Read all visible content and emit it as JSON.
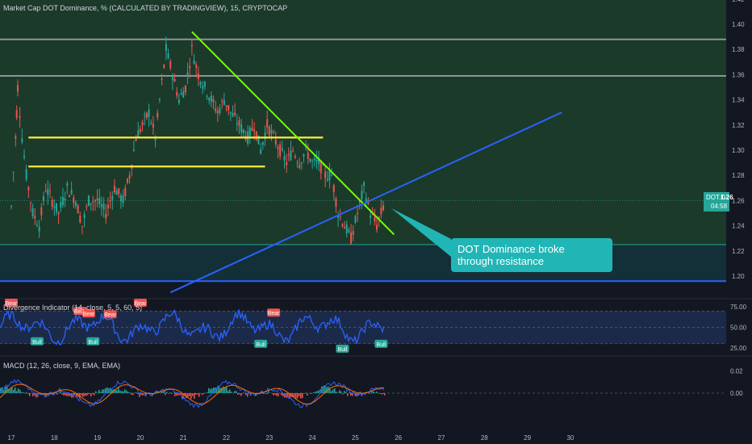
{
  "header": {
    "title": "Market Cap DOT Dominance, % (CALCULATED BY TRADINGVIEW), 15, CRYPTOCAP",
    "rsi_title": "Divergence Indicator (14, close, 5, 5, 60, 5)",
    "macd_title": "MACD (12, 26, close, 9, EMA, EMA)"
  },
  "price_tag": {
    "symbol": "DOT.D",
    "value": "1.26",
    "countdown": "04:58"
  },
  "callout": {
    "line1": "DOT Dominance broke",
    "line2": "through resistance"
  },
  "colors": {
    "background": "#131722",
    "candle_up": "#26a69a",
    "candle_down": "#ef5350",
    "resistance": "#ffeb3b",
    "trendline_down": "#76ff03",
    "trendline_up": "#2962ff",
    "support": "#2962ff",
    "zone_upper": "#1b3a2a",
    "zone_lower": "#133038"
  },
  "chart_data": [
    {
      "type": "candlestick",
      "title": "Market Cap DOT Dominance, %",
      "x_ticks": [
        "17",
        "18",
        "19",
        "20",
        "21",
        "22",
        "23",
        "24",
        "25",
        "26",
        "27",
        "28",
        "29",
        "30"
      ],
      "y_ticks": [
        "1.20",
        "1.22",
        "1.24",
        "1.26",
        "1.28",
        "1.30",
        "1.32",
        "1.34",
        "1.36",
        "1.38",
        "1.40",
        "1.42"
      ],
      "ylim": [
        1.187,
        1.42
      ],
      "last_value": 1.26,
      "approx_close": [
        [
          17.0,
          1.255
        ],
        [
          17.1,
          1.31
        ],
        [
          17.15,
          1.35
        ],
        [
          17.25,
          1.31
        ],
        [
          17.35,
          1.28
        ],
        [
          17.5,
          1.25
        ],
        [
          17.65,
          1.24
        ],
        [
          17.8,
          1.27
        ],
        [
          17.95,
          1.26
        ],
        [
          18.1,
          1.25
        ],
        [
          18.3,
          1.27
        ],
        [
          18.5,
          1.26
        ],
        [
          18.65,
          1.24
        ],
        [
          18.8,
          1.26
        ],
        [
          19.0,
          1.26
        ],
        [
          19.2,
          1.25
        ],
        [
          19.4,
          1.27
        ],
        [
          19.6,
          1.26
        ],
        [
          19.75,
          1.28
        ],
        [
          19.9,
          1.31
        ],
        [
          20.05,
          1.32
        ],
        [
          20.2,
          1.33
        ],
        [
          20.35,
          1.31
        ],
        [
          20.45,
          1.34
        ],
        [
          20.6,
          1.38
        ],
        [
          20.75,
          1.36
        ],
        [
          20.9,
          1.34
        ],
        [
          21.05,
          1.35
        ],
        [
          21.2,
          1.38
        ],
        [
          21.35,
          1.36
        ],
        [
          21.5,
          1.35
        ],
        [
          21.65,
          1.34
        ],
        [
          21.8,
          1.33
        ],
        [
          21.95,
          1.34
        ],
        [
          22.1,
          1.33
        ],
        [
          22.3,
          1.32
        ],
        [
          22.5,
          1.31
        ],
        [
          22.65,
          1.32
        ],
        [
          22.8,
          1.3
        ],
        [
          22.95,
          1.32
        ],
        [
          23.1,
          1.31
        ],
        [
          23.25,
          1.3
        ],
        [
          23.4,
          1.29
        ],
        [
          23.55,
          1.3
        ],
        [
          23.7,
          1.29
        ],
        [
          23.85,
          1.3
        ],
        [
          24.0,
          1.29
        ],
        [
          24.15,
          1.29
        ],
        [
          24.3,
          1.28
        ],
        [
          24.45,
          1.28
        ],
        [
          24.6,
          1.25
        ],
        [
          24.75,
          1.24
        ],
        [
          24.9,
          1.23
        ],
        [
          25.05,
          1.25
        ],
        [
          25.2,
          1.27
        ],
        [
          25.35,
          1.25
        ],
        [
          25.5,
          1.24
        ],
        [
          25.6,
          1.25
        ],
        [
          25.7,
          1.26
        ]
      ],
      "horizontal_lines": [
        {
          "name": "upper-level",
          "y": 1.388
        },
        {
          "name": "mid-level",
          "y": 1.359
        },
        {
          "name": "support-line",
          "y": 1.196
        }
      ],
      "resistance_lines": [
        {
          "y": 1.31,
          "x_from": 17.4,
          "x_to": 24.25
        },
        {
          "y": 1.287,
          "x_from": 17.4,
          "x_to": 22.9
        }
      ],
      "trendlines": [
        {
          "name": "downtrend",
          "from": [
            21.2,
            1.394
          ],
          "to": [
            25.9,
            1.233
          ]
        },
        {
          "name": "uptrend",
          "from": [
            20.7,
            1.187
          ],
          "to": [
            29.8,
            1.33
          ]
        }
      ]
    },
    {
      "type": "line",
      "title": "Divergence Indicator",
      "y_ticks": [
        "75.00",
        "50.00",
        "25.00"
      ],
      "ylim": [
        20,
        80
      ],
      "band": [
        30,
        70
      ],
      "labels": [
        {
          "text": "Bear",
          "x": 18.6,
          "y": 70
        },
        {
          "text": "Bear",
          "x": 18.8,
          "y": 67
        },
        {
          "text": "Bear",
          "x": 19.3,
          "y": 66
        },
        {
          "text": "Bear",
          "x": 23.1,
          "y": 68
        },
        {
          "text": "Bear",
          "x": 17.0,
          "y": 80
        },
        {
          "text": "Bear",
          "x": 20.0,
          "y": 80
        },
        {
          "text": "Bull",
          "x": 17.6,
          "y": 33
        },
        {
          "text": "Bull",
          "x": 18.9,
          "y": 33
        },
        {
          "text": "Bull",
          "x": 22.8,
          "y": 30
        },
        {
          "text": "Bull",
          "x": 24.7,
          "y": 24
        },
        {
          "text": "Bull",
          "x": 25.6,
          "y": 30
        }
      ]
    },
    {
      "type": "line",
      "title": "MACD",
      "y_ticks": [
        "0.02",
        "0.00"
      ],
      "ylim": [
        -0.03,
        0.03
      ]
    }
  ]
}
